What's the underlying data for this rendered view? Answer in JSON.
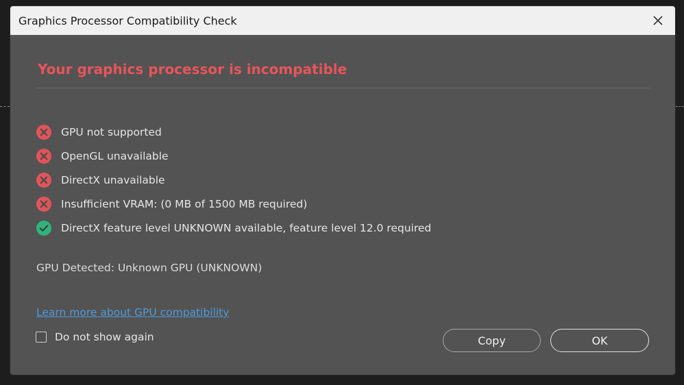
{
  "window": {
    "title": "Graphics Processor Compatibility Check",
    "close_icon": "close-icon"
  },
  "heading": "Your graphics processor is incompatible",
  "checks": [
    {
      "status": "fail",
      "icon": "error-x-icon",
      "text": "GPU not supported"
    },
    {
      "status": "fail",
      "icon": "error-x-icon",
      "text": "OpenGL unavailable"
    },
    {
      "status": "fail",
      "icon": "error-x-icon",
      "text": "DirectX unavailable"
    },
    {
      "status": "fail",
      "icon": "error-x-icon",
      "text": "Insufficient VRAM: (0 MB of 1500 MB required)"
    },
    {
      "status": "pass",
      "icon": "check-circle-icon",
      "text": "DirectX feature level UNKNOWN available, feature level 12.0 required"
    }
  ],
  "gpu_detected": "GPU Detected: Unknown GPU (UNKNOWN)",
  "learn_more_link": "Learn more about GPU compatibility",
  "dont_show_again": {
    "label": "Do not show again",
    "checked": false
  },
  "buttons": {
    "copy": "Copy",
    "ok": "OK"
  },
  "colors": {
    "error": "#e0555a",
    "success": "#2fb37b",
    "heading": "#e8555b",
    "link": "#4f9bd9",
    "dialog_bg": "#535353",
    "titlebar_bg": "#f0f0f0"
  }
}
